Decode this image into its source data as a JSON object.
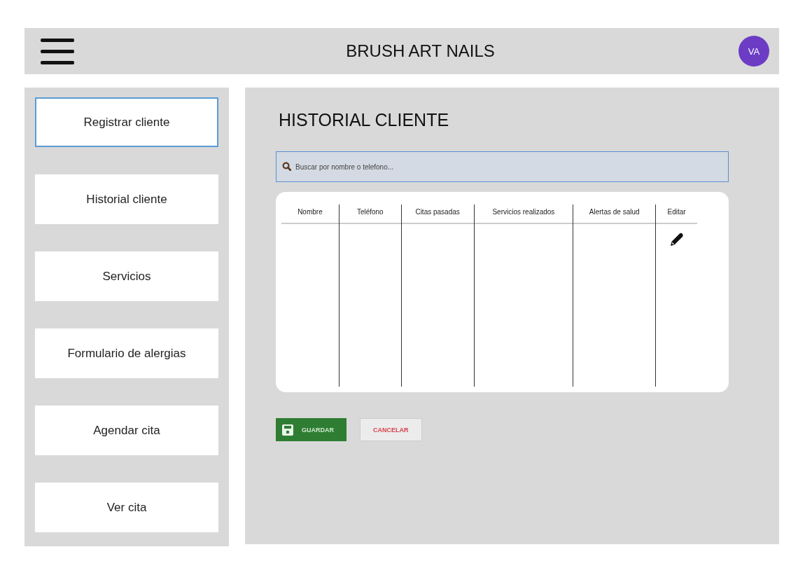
{
  "header": {
    "title": "BRUSH ART NAILS",
    "avatar": "VA"
  },
  "sidebar": {
    "items": [
      {
        "label": "Registrar cliente",
        "selected": true
      },
      {
        "label": "Historial cliente",
        "selected": false
      },
      {
        "label": "Servicios",
        "selected": false
      },
      {
        "label": "Formulario de alergias",
        "selected": false
      },
      {
        "label": "Agendar cita",
        "selected": false
      },
      {
        "label": "Ver cita",
        "selected": false
      }
    ]
  },
  "main": {
    "title": "HISTORIAL CLIENTE",
    "search": {
      "placeholder": "Buscar por nombre o telefono..."
    },
    "table": {
      "columns": [
        "Nombre",
        "Teléfono",
        "Citas pasadas",
        "Servicios realizados",
        "Alertas de salud",
        "Editar"
      ]
    },
    "buttons": [
      {
        "label": "GUARDAR",
        "kind": "primary"
      },
      {
        "label": "CANCELAR",
        "kind": "secondary"
      }
    ]
  }
}
